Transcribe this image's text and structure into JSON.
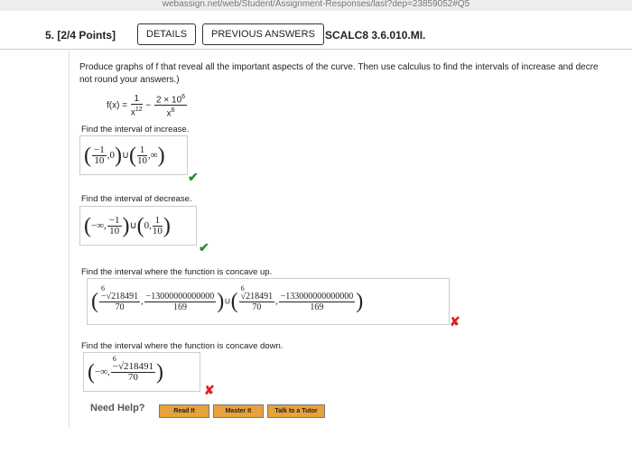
{
  "browser": {
    "url_fragment": "webassign.net/web/Student/Assignment-Responses/last?dep=23859052#Q5"
  },
  "question": {
    "number": "5. [2/4 Points]",
    "details_label": "DETAILS",
    "previous_label": "PREVIOUS ANSWERS",
    "code": "SCALC8 3.6.010.MI."
  },
  "prompt": {
    "line1": "Produce graphs of f that reveal all the important aspects of the curve. Then use calculus to find the intervals of increase and decre",
    "line2": "not round your answers.)"
  },
  "function": {
    "lhs": "f(x) =",
    "f1_num": "1",
    "f1_den": "x",
    "f1_den_exp": "12",
    "minus": "−",
    "f2_num": "2 × 10",
    "f2_num_exp": "6",
    "f2_den": "x",
    "f2_den_exp": "6"
  },
  "increase": {
    "label": "Find the interval of increase.",
    "a_num": "−1",
    "a_den": "10",
    "a_right": "0",
    "b_num": "1",
    "b_den": "10",
    "b_right": "∞",
    "status": "correct"
  },
  "decrease": {
    "label": "Find the interval of decrease.",
    "a_left": "−∞,",
    "a_num": "−1",
    "a_den": "10",
    "b_left": "0,",
    "b_num": "1",
    "b_den": "10",
    "status": "correct"
  },
  "concave_up": {
    "label": "Find the interval where the function is concave up.",
    "r_index": "6",
    "r_num": "218491",
    "r_den": "70",
    "c_num": "−13000000000000",
    "c_den": "169",
    "r2_index": "6",
    "r2_num": "218491",
    "r2_den": "70",
    "c2_num": "−133000000000000",
    "c2_den": "169",
    "status": "incorrect"
  },
  "concave_down": {
    "label": "Find the interval where the function is concave down.",
    "left": "−∞,",
    "r_index": "6",
    "r_num": "218491",
    "r_den": "70",
    "status": "incorrect"
  },
  "help": {
    "label": "Need Help?",
    "read": "Read It",
    "master": "Master It",
    "tutor": "Talk to a Tutor"
  },
  "colors": {
    "check": "#2e8b2e",
    "x": "#d22",
    "help_button": "#e8a13b"
  }
}
